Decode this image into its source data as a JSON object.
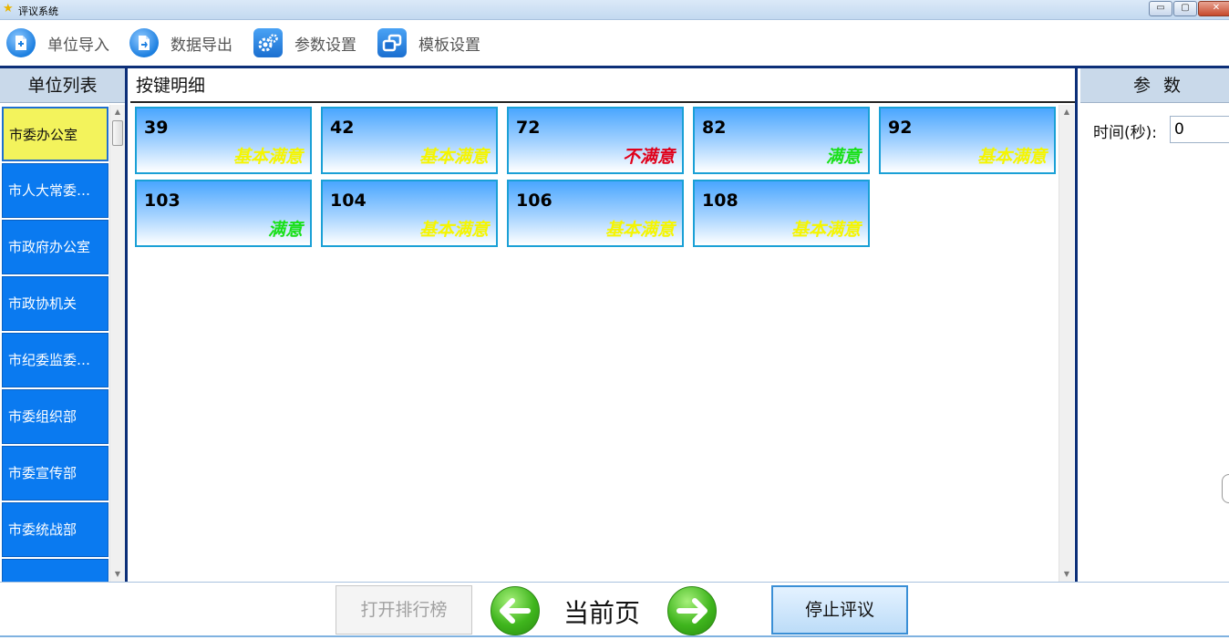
{
  "window": {
    "title": "评议系统",
    "controls": {
      "minimize": "▭",
      "maximize": "▢",
      "close": "✕"
    }
  },
  "toolbar": {
    "items": [
      {
        "label": "单位导入",
        "icon": "import-document-icon"
      },
      {
        "label": "数据导出",
        "icon": "export-document-icon"
      },
      {
        "label": "参数设置",
        "icon": "gears-icon"
      },
      {
        "label": "模板设置",
        "icon": "template-window-icon"
      }
    ]
  },
  "unit_panel": {
    "header": "单位列表",
    "items": [
      {
        "label": "市委办公室",
        "selected": true
      },
      {
        "label": "市人大常委…",
        "selected": false
      },
      {
        "label": "市政府办公室",
        "selected": false
      },
      {
        "label": "市政协机关",
        "selected": false
      },
      {
        "label": "市纪委监委…",
        "selected": false
      },
      {
        "label": "市委组织部",
        "selected": false
      },
      {
        "label": "市委宣传部",
        "selected": false
      },
      {
        "label": "市委统战部",
        "selected": false
      }
    ]
  },
  "detail_panel": {
    "header": "按键明细",
    "cards": [
      {
        "number": "39",
        "rating": "基本满意",
        "rating_color": "#f5f500"
      },
      {
        "number": "42",
        "rating": "基本满意",
        "rating_color": "#f5f500"
      },
      {
        "number": "72",
        "rating": "不满意",
        "rating_color": "#e0001a"
      },
      {
        "number": "82",
        "rating": "满意",
        "rating_color": "#19e019"
      },
      {
        "number": "92",
        "rating": "基本满意",
        "rating_color": "#f5f500"
      },
      {
        "number": "103",
        "rating": "满意",
        "rating_color": "#19e019"
      },
      {
        "number": "104",
        "rating": "基本满意",
        "rating_color": "#f5f500"
      },
      {
        "number": "106",
        "rating": "基本满意",
        "rating_color": "#f5f500"
      },
      {
        "number": "108",
        "rating": "基本满意",
        "rating_color": "#f5f500"
      }
    ]
  },
  "param_panel": {
    "header": "参数",
    "time_label": "时间(秒):",
    "time_value": "0"
  },
  "bottom_bar": {
    "open_ranking_label": "打开排行榜",
    "prev_icon": "arrow-left-icon",
    "current_page_label": "当前页",
    "next_icon": "arrow-right-icon",
    "stop_label": "停止评议"
  },
  "colors": {
    "accent_blue": "#0a7af0",
    "selected_yellow": "#f3f35c",
    "frame_navy": "#0c2f78",
    "nav_green": "#3fb51d"
  }
}
